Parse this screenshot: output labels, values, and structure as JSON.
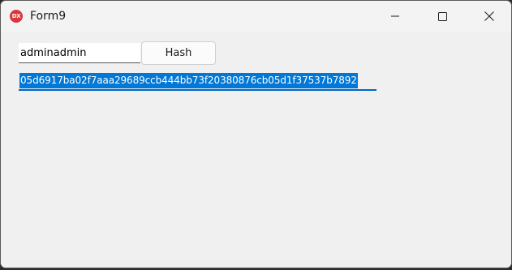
{
  "window": {
    "title": "Form9",
    "app_icon_text": "DX",
    "controls": {
      "minimize": "minimize-icon",
      "maximize": "maximize-icon",
      "close": "close-icon"
    }
  },
  "form": {
    "input_value": "adminadmin",
    "hash_button_label": "Hash",
    "output_value": "05d6917ba02f7aaa29689ccb444bb73f20380876cb05d1f37537b7892"
  },
  "colors": {
    "selection": "#0078d7",
    "focus_underline": "#0067c0",
    "app_icon": "#d9363e",
    "background": "#f0f0f0"
  }
}
